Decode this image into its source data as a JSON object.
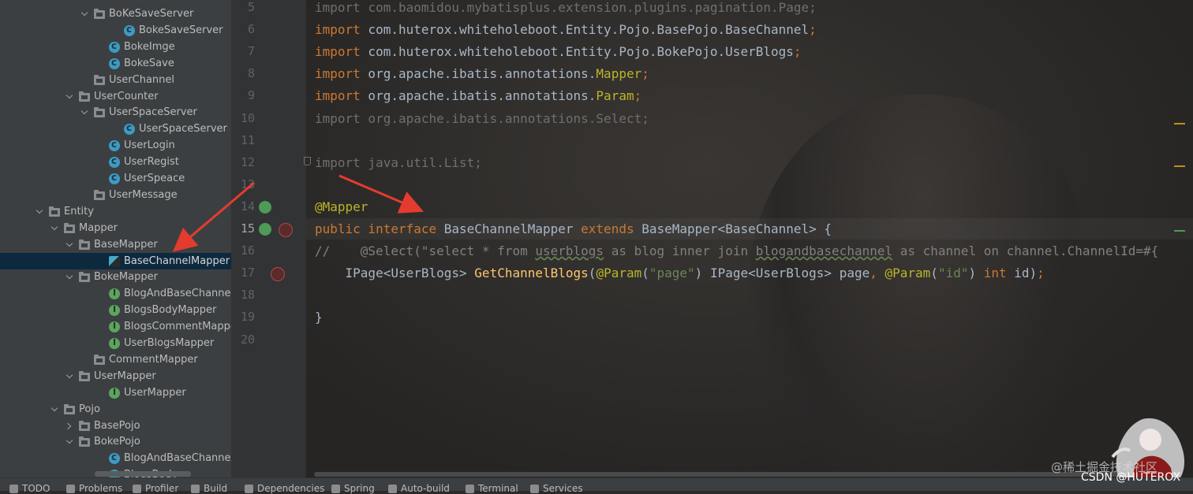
{
  "tree": {
    "items": [
      {
        "label": "BoKeSaveServer",
        "type": "folder",
        "expanded": true,
        "depth": 5
      },
      {
        "label": "BokeSaveServer",
        "type": "class",
        "depth": 7
      },
      {
        "label": "BokeImge",
        "type": "class",
        "depth": 6
      },
      {
        "label": "BokeSave",
        "type": "class",
        "depth": 6
      },
      {
        "label": "UserChannel",
        "type": "folder",
        "expanded": null,
        "depth": 5
      },
      {
        "label": "UserCounter",
        "type": "folder",
        "expanded": true,
        "depth": 4
      },
      {
        "label": "UserSpaceServer",
        "type": "folder",
        "expanded": true,
        "depth": 5
      },
      {
        "label": "UserSpaceServer",
        "type": "class",
        "depth": 7
      },
      {
        "label": "UserLogin",
        "type": "class",
        "depth": 6
      },
      {
        "label": "UserRegist",
        "type": "class",
        "depth": 6
      },
      {
        "label": "UserSpeace",
        "type": "class",
        "depth": 6
      },
      {
        "label": "UserMessage",
        "type": "folder",
        "expanded": null,
        "depth": 5
      },
      {
        "label": "Entity",
        "type": "folder",
        "expanded": true,
        "depth": 2
      },
      {
        "label": "Mapper",
        "type": "folder",
        "expanded": true,
        "depth": 3
      },
      {
        "label": "BaseMapper",
        "type": "folder",
        "expanded": true,
        "depth": 4
      },
      {
        "label": "BaseChannelMapper",
        "type": "mapper",
        "depth": 6,
        "selected": true
      },
      {
        "label": "BokeMapper",
        "type": "folder",
        "expanded": true,
        "depth": 4
      },
      {
        "label": "BlogAndBaseChannelMapper",
        "type": "iface",
        "depth": 6
      },
      {
        "label": "BlogsBodyMapper",
        "type": "iface",
        "depth": 6
      },
      {
        "label": "BlogsCommentMapper",
        "type": "iface",
        "depth": 6
      },
      {
        "label": "UserBlogsMapper",
        "type": "iface",
        "depth": 6
      },
      {
        "label": "CommentMapper",
        "type": "folder",
        "expanded": null,
        "depth": 5
      },
      {
        "label": "UserMapper",
        "type": "folder",
        "expanded": true,
        "depth": 4
      },
      {
        "label": "UserMapper",
        "type": "iface",
        "depth": 6
      },
      {
        "label": "Pojo",
        "type": "folder",
        "expanded": true,
        "depth": 3
      },
      {
        "label": "BasePojo",
        "type": "folder",
        "expanded": false,
        "depth": 4
      },
      {
        "label": "BokePojo",
        "type": "folder",
        "expanded": true,
        "depth": 4
      },
      {
        "label": "BlogAndBaseChannel",
        "type": "class",
        "depth": 6
      },
      {
        "label": "BlogsBody",
        "type": "class",
        "depth": 6
      }
    ]
  },
  "editor": {
    "line_numbers": [
      "5",
      "6",
      "7",
      "8",
      "9",
      "10",
      "11",
      "12",
      "13",
      "14",
      "15",
      "16",
      "17",
      "18",
      "19",
      "20"
    ],
    "current_line": "15",
    "lines": [
      [
        {
          "t": "import com.baomidou.mybatisplus.extension.plugins.pagination.Page;",
          "c": "gray"
        }
      ],
      [
        {
          "t": "import",
          "c": "kw"
        },
        {
          "t": " com.huterox.whiteholeboot.Entity.Pojo.BasePojo.BaseChannel",
          "c": ""
        },
        {
          "t": ";",
          "c": "kw"
        }
      ],
      [
        {
          "t": "import",
          "c": "kw"
        },
        {
          "t": " com.huterox.whiteholeboot.Entity.Pojo.BokePojo.UserBlogs",
          "c": ""
        },
        {
          "t": ";",
          "c": "kw"
        }
      ],
      [
        {
          "t": "import",
          "c": "kw"
        },
        {
          "t": " org.apache.ibatis.annotations.",
          "c": ""
        },
        {
          "t": "Mapper",
          "c": "ann"
        },
        {
          "t": ";",
          "c": "kw"
        }
      ],
      [
        {
          "t": "import",
          "c": "kw"
        },
        {
          "t": " org.apache.ibatis.annotations.",
          "c": ""
        },
        {
          "t": "Param",
          "c": "ann"
        },
        {
          "t": ";",
          "c": "kw"
        }
      ],
      [
        {
          "t": "import org.apache.ibatis.annotations.Select;",
          "c": "gray"
        }
      ],
      [],
      [
        {
          "t": "import java.util.List;",
          "c": "gray"
        }
      ],
      [],
      [
        {
          "t": "@Mapper",
          "c": "ann"
        }
      ],
      [
        {
          "t": "public interface",
          "c": "kw"
        },
        {
          "t": " BaseChannelMapper ",
          "c": ""
        },
        {
          "t": "extends",
          "c": "kw"
        },
        {
          "t": " BaseMapper<BaseChannel> {",
          "c": ""
        }
      ],
      [
        {
          "t": "//    @Select(\"select * from ",
          "c": "cmt"
        },
        {
          "t": "userblogs",
          "c": "cmt ul"
        },
        {
          "t": " as blog inner join ",
          "c": "cmt"
        },
        {
          "t": "blogandbasechannel",
          "c": "cmt ul"
        },
        {
          "t": " as channel on channel.ChannelId=#{",
          "c": "cmt"
        }
      ],
      [
        {
          "t": "    IPage<UserBlogs> ",
          "c": ""
        },
        {
          "t": "GetChannelBlogs",
          "c": "fn"
        },
        {
          "t": "(",
          "c": ""
        },
        {
          "t": "@Param",
          "c": "ann"
        },
        {
          "t": "(",
          "c": ""
        },
        {
          "t": "\"page\"",
          "c": "str"
        },
        {
          "t": ") IPage<UserBlogs> page",
          "c": ""
        },
        {
          "t": ", ",
          "c": "kw"
        },
        {
          "t": "@Param",
          "c": "ann"
        },
        {
          "t": "(",
          "c": ""
        },
        {
          "t": "\"id\"",
          "c": "str"
        },
        {
          "t": ") ",
          "c": ""
        },
        {
          "t": "int",
          "c": "kw"
        },
        {
          "t": " id)",
          "c": ""
        },
        {
          "t": ";",
          "c": "kw"
        }
      ],
      [],
      [
        {
          "t": "}",
          "c": ""
        }
      ],
      []
    ]
  },
  "toolwindows": [
    {
      "label": "TODO",
      "icon": "list-icon"
    },
    {
      "label": "Problems",
      "icon": "warning-icon"
    },
    {
      "label": "Profiler",
      "icon": "profiler-icon"
    },
    {
      "label": "Build",
      "icon": "hammer-icon"
    },
    {
      "label": "Dependencies",
      "icon": "dependencies-icon"
    },
    {
      "label": "Spring",
      "icon": "spring-icon"
    },
    {
      "label": "Auto-build",
      "icon": "autobuild-icon"
    },
    {
      "label": "Terminal",
      "icon": "terminal-icon"
    },
    {
      "label": "Services",
      "icon": "services-icon"
    }
  ],
  "watermark": {
    "line1": "@稀土掘金技术社区",
    "line2": "CSDN @HUTEROX"
  }
}
